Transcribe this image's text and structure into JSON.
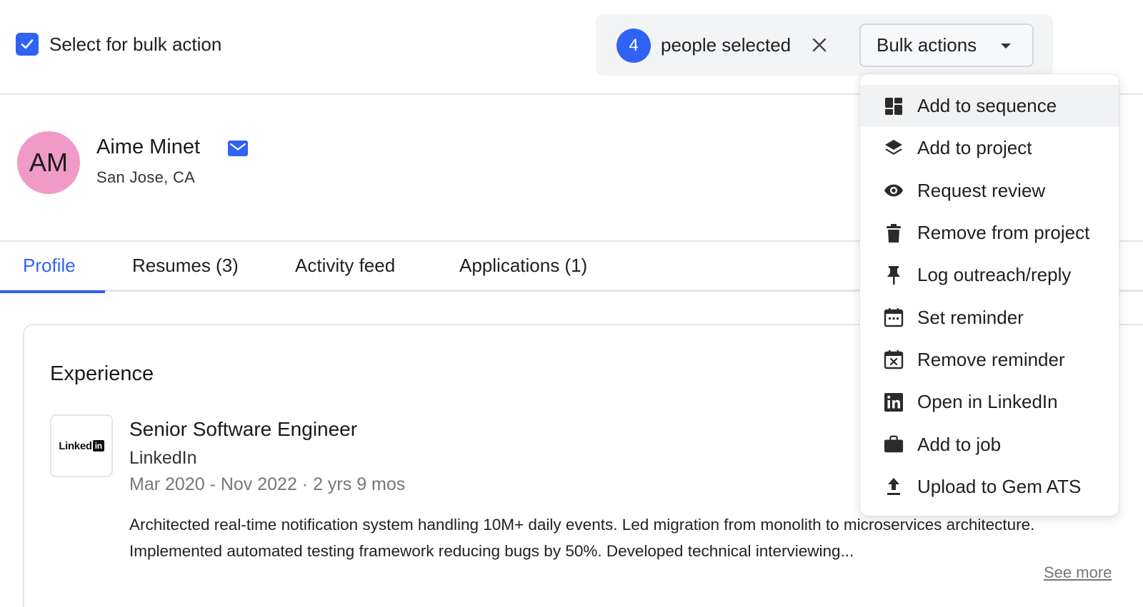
{
  "toolbar": {
    "select_label": "Select for bulk action",
    "selected_count": "4",
    "selected_text": "people selected",
    "bulk_actions_label": "Bulk actions"
  },
  "person": {
    "initials": "AM",
    "name": "Aime Minet",
    "location": "San Jose, CA",
    "avatar_color": "#ef9ac7"
  },
  "tabs": [
    {
      "label": "Profile",
      "active": true
    },
    {
      "label": "Resumes (3)",
      "active": false
    },
    {
      "label": "Activity feed",
      "active": false
    },
    {
      "label": "Applications (1)",
      "active": false
    }
  ],
  "experience": {
    "heading": "Experience",
    "logo_text": "Linked",
    "logo_in": "in",
    "title": "Senior Software Engineer",
    "company": "LinkedIn",
    "dates": "Mar 2020 - Nov 2022 · 2 yrs 9 mos",
    "description": "Architected real-time notification system handling 10M+ daily events. Led migration from monolith to microservices architecture. Implemented automated testing framework reducing bugs by 50%. Developed technical interviewing...",
    "see_more": "See more"
  },
  "menu": {
    "items": [
      {
        "label": "Add to sequence",
        "icon": "dashboard-icon"
      },
      {
        "label": "Add to project",
        "icon": "layers-icon"
      },
      {
        "label": "Request review",
        "icon": "eye-icon"
      },
      {
        "label": "Remove from project",
        "icon": "trash-icon"
      },
      {
        "label": "Log outreach/reply",
        "icon": "pin-icon"
      },
      {
        "label": "Set reminder",
        "icon": "calendar-icon"
      },
      {
        "label": "Remove reminder",
        "icon": "calendar-remove-icon"
      },
      {
        "label": "Open in LinkedIn",
        "icon": "linkedin-icon"
      },
      {
        "label": "Add to job",
        "icon": "briefcase-icon"
      },
      {
        "label": "Upload to Gem ATS",
        "icon": "upload-icon"
      }
    ]
  },
  "colors": {
    "accent": "#2f62f5",
    "pill_bg": "#f3f4f6",
    "muted_text": "#777777"
  }
}
